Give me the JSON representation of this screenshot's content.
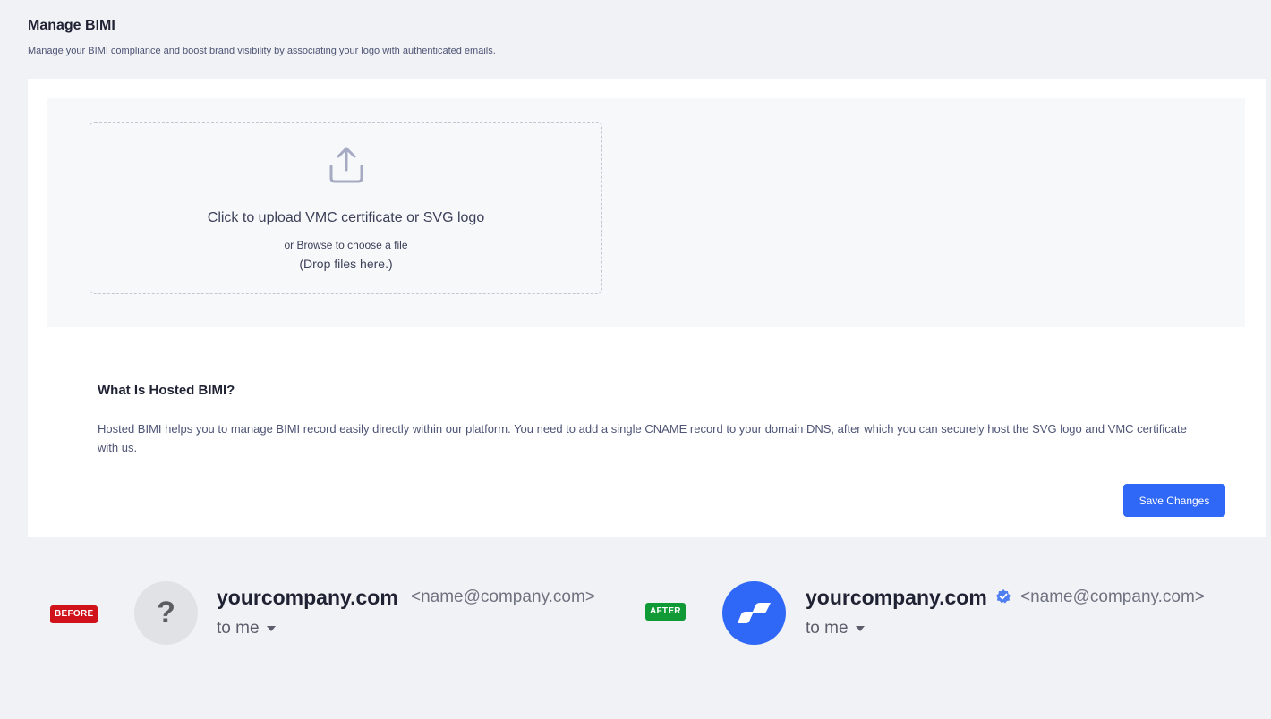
{
  "header": {
    "title": "Manage BIMI",
    "subtitle": "Manage your BIMI compliance and boost brand visibility by associating your logo with authenticated emails."
  },
  "upload": {
    "icon": "upload-icon",
    "main_text": "Click to upload VMC certificate or SVG logo",
    "browse_text": "or Browse to choose a file",
    "drop_text": "(Drop files here.)"
  },
  "info": {
    "title": "What Is Hosted BIMI?",
    "text": "Hosted BIMI helps you to manage BIMI record easily directly within our platform. You need to add a single CNAME record to your domain DNS, after which you can securely host the SVG logo and VMC certificate with us."
  },
  "actions": {
    "save_label": "Save Changes"
  },
  "preview": {
    "before": {
      "badge": "BEFORE",
      "avatar_glyph": "?",
      "domain": "yourcompany.com",
      "email": "<name@company.com>",
      "recipient": "to me"
    },
    "after": {
      "badge": "AFTER",
      "domain": "yourcompany.com",
      "email": "<name@company.com>",
      "recipient": "to me",
      "verified_icon": "verified-badge-icon"
    }
  },
  "colors": {
    "primary": "#2f67f6",
    "before_badge": "#d0121b",
    "after_badge": "#0f9a36"
  }
}
